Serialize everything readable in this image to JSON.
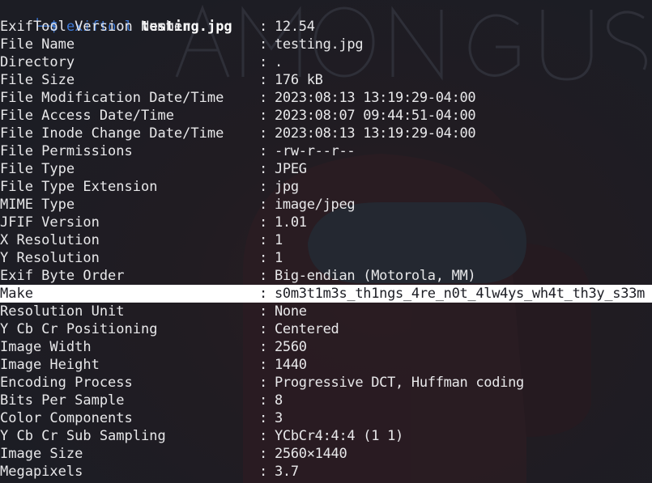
{
  "prompt": {
    "corner": "└─",
    "dollar": "$",
    "command": "exiftool",
    "argument": "testing.jpg"
  },
  "rows": [
    {
      "key": "ExifTool Version Number",
      "sep": ":",
      "value": "12.54"
    },
    {
      "key": "File Name",
      "sep": ":",
      "value": "testing.jpg"
    },
    {
      "key": "Directory",
      "sep": ":",
      "value": "."
    },
    {
      "key": "File Size",
      "sep": ":",
      "value": "176 kB"
    },
    {
      "key": "File Modification Date/Time",
      "sep": ":",
      "value": "2023:08:13 13:19:29-04:00"
    },
    {
      "key": "File Access Date/Time",
      "sep": ":",
      "value": "2023:08:07 09:44:51-04:00"
    },
    {
      "key": "File Inode Change Date/Time",
      "sep": ":",
      "value": "2023:08:13 13:19:29-04:00"
    },
    {
      "key": "File Permissions",
      "sep": ":",
      "value": "-rw-r--r--"
    },
    {
      "key": "File Type",
      "sep": ":",
      "value": "JPEG"
    },
    {
      "key": "File Type Extension",
      "sep": ":",
      "value": "jpg"
    },
    {
      "key": "MIME Type",
      "sep": ":",
      "value": "image/jpeg"
    },
    {
      "key": "JFIF Version",
      "sep": ":",
      "value": "1.01"
    },
    {
      "key": "X Resolution",
      "sep": ":",
      "value": "1"
    },
    {
      "key": "Y Resolution",
      "sep": ":",
      "value": "1"
    },
    {
      "key": "Exif Byte Order",
      "sep": ":",
      "value": "Big-endian (Motorola, MM)"
    },
    {
      "key": "Make",
      "sep": ":",
      "value": "s0m3t1m3s_th1ngs_4re_n0t_4lw4ys_wh4t_th3y_s33m",
      "highlighted": true
    },
    {
      "key": "Resolution Unit",
      "sep": ":",
      "value": "None"
    },
    {
      "key": "Y Cb Cr Positioning",
      "sep": ":",
      "value": "Centered"
    },
    {
      "key": "Image Width",
      "sep": ":",
      "value": "2560"
    },
    {
      "key": "Image Height",
      "sep": ":",
      "value": "1440"
    },
    {
      "key": "Encoding Process",
      "sep": ":",
      "value": "Progressive DCT, Huffman coding"
    },
    {
      "key": "Bits Per Sample",
      "sep": ":",
      "value": "8"
    },
    {
      "key": "Color Components",
      "sep": ":",
      "value": "3"
    },
    {
      "key": "Y Cb Cr Sub Sampling",
      "sep": ":",
      "value": "YCbCr4:4:4 (1 1)"
    },
    {
      "key": "Image Size",
      "sep": ":",
      "value": "2560×1440"
    },
    {
      "key": "Megapixels",
      "sep": ":",
      "value": "3.7"
    }
  ],
  "colors": {
    "background": "#1c1d24",
    "text": "#e8e8ea",
    "prompt_accent": "#3f7bd8",
    "highlight_bg": "#ffffff",
    "highlight_text": "#1c1d24"
  }
}
